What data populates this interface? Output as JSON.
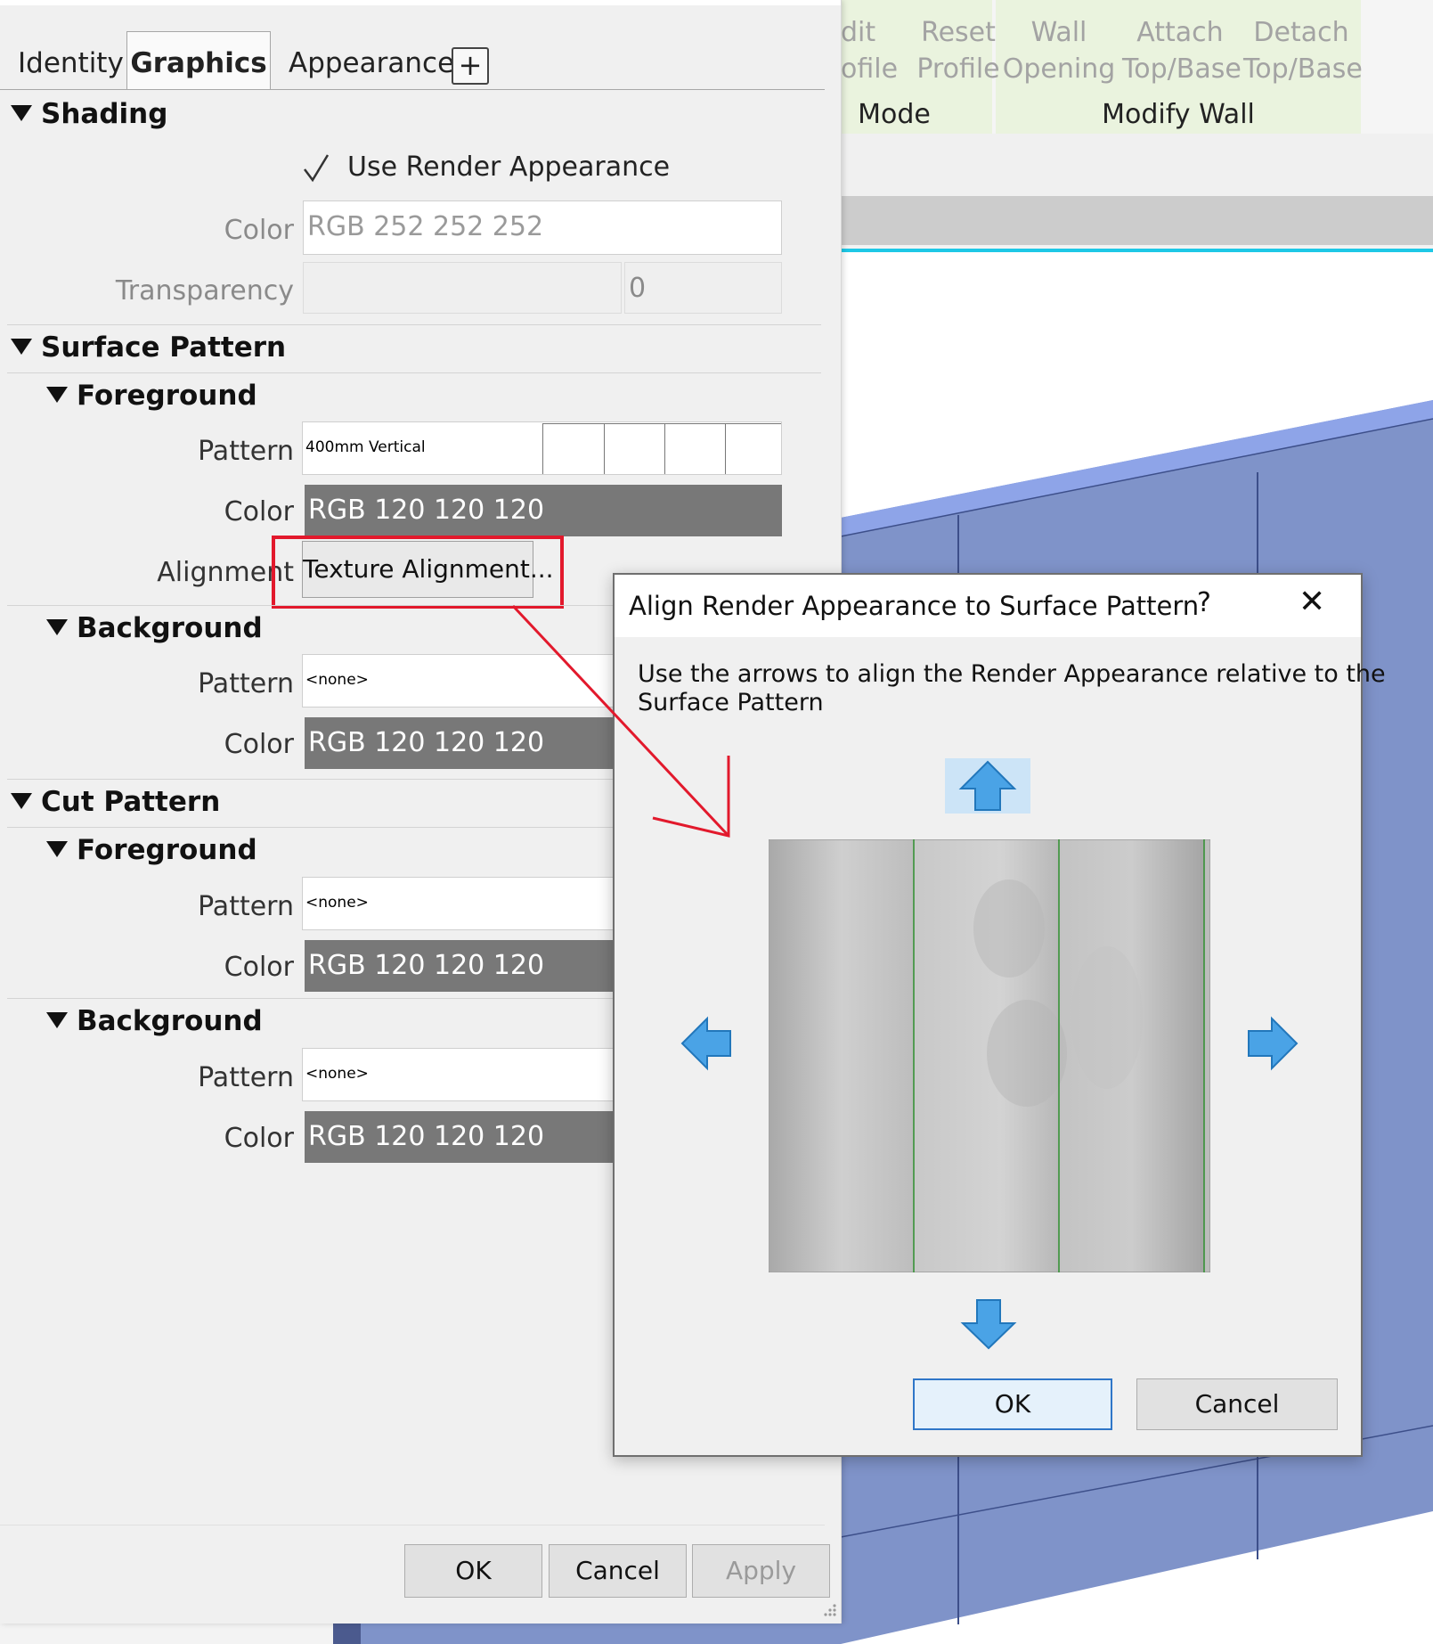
{
  "ribbon": {
    "buttons": [
      {
        "line1": "dit",
        "line2": "ofile"
      },
      {
        "line1": "Reset",
        "line2": "Profile"
      },
      {
        "line1": "Wall",
        "line2": "Opening"
      },
      {
        "line1": "Attach",
        "line2": "Top/Base"
      },
      {
        "line1": "Detach",
        "line2": "Top/Base"
      }
    ],
    "panels": {
      "mode": "Mode",
      "modify_wall": "Modify Wall"
    }
  },
  "tabs": {
    "identity": "Identity",
    "graphics": "Graphics",
    "appearance": "Appearance",
    "add": "+",
    "active": "Graphics"
  },
  "shading": {
    "title": "Shading",
    "use_render_appearance": {
      "label": "Use Render Appearance",
      "checked": true
    },
    "color_label": "Color",
    "color_value": "RGB 252 252 252",
    "transparency_label": "Transparency",
    "transparency_value": "0"
  },
  "surface_pattern": {
    "title": "Surface Pattern",
    "foreground": {
      "title": "Foreground",
      "pattern_label": "Pattern",
      "pattern_value": "400mm Vertical",
      "color_label": "Color",
      "color_value": "RGB 120 120 120",
      "alignment_label": "Alignment",
      "alignment_button": "Texture Alignment..."
    },
    "background": {
      "title": "Background",
      "pattern_label": "Pattern",
      "pattern_value": "<none>",
      "color_label": "Color",
      "color_value": "RGB 120 120 120"
    }
  },
  "cut_pattern": {
    "title": "Cut Pattern",
    "foreground": {
      "title": "Foreground",
      "pattern_label": "Pattern",
      "pattern_value": "<none>",
      "color_label": "Color",
      "color_value": "RGB 120 120 120"
    },
    "background": {
      "title": "Background",
      "pattern_label": "Pattern",
      "pattern_value": "<none>",
      "color_label": "Color",
      "color_value": "RGB 120 120 120"
    }
  },
  "footer": {
    "ok": "OK",
    "cancel": "Cancel",
    "apply": "Apply"
  },
  "align_dialog": {
    "title": "Align Render Appearance to Surface Pattern",
    "help": "?",
    "close": "✕",
    "instruction_line1": "Use the arrows to align the Render Appearance relative to the",
    "instruction_line2": "Surface Pattern",
    "ok": "OK",
    "cancel": "Cancel"
  },
  "colors": {
    "accent_red": "#e2192c",
    "arrow_blue": "#4aa3e6",
    "wall_blue": "#7f93c9",
    "ribbon_panel_green": "#eaf3de",
    "swatch_grey": "#787878"
  },
  "icons": [
    "checkmark-icon",
    "arrow-up-icon",
    "arrow-down-icon",
    "arrow-left-icon",
    "arrow-right-icon",
    "close-icon",
    "help-icon",
    "collapse-triangle-icon",
    "resize-grip-icon"
  ]
}
